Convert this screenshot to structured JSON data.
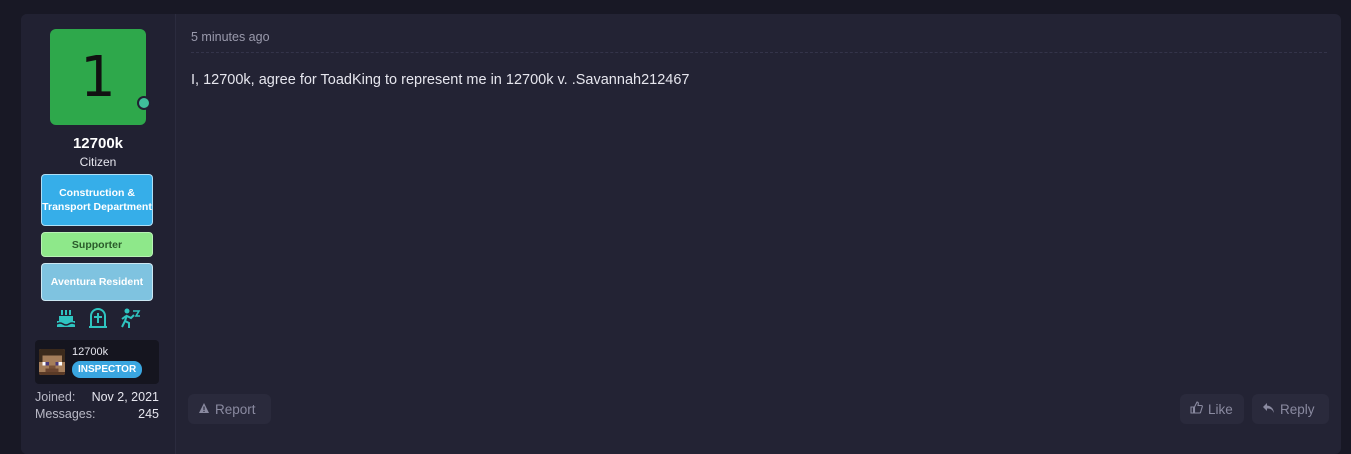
{
  "post": {
    "time": "5 minutes ago",
    "message": "I, 12700k, agree for ToadKing to represent me in 12700k v. .Savannah212467",
    "actions": {
      "report": "Report",
      "like": "Like",
      "reply": "Reply"
    }
  },
  "user": {
    "avatar_letter": "1",
    "avatar_color": "#2ea84b",
    "name": "12700k",
    "title": "Citizen",
    "banners": [
      {
        "label": "Construction & Transport Department",
        "color": "#36aee9"
      },
      {
        "label": "Supporter",
        "color": "#8ee88a"
      },
      {
        "label": "Aventura Resident",
        "color": "#7fc3e0"
      }
    ],
    "trophy_icons": [
      "birthday-cake-icon",
      "gravestone-icon",
      "runner-icon"
    ],
    "minecraft": {
      "name": "12700k",
      "badge": "INSPECTOR"
    },
    "stats": [
      {
        "label": "Joined:",
        "value": "Nov 2, 2021"
      },
      {
        "label": "Messages:",
        "value": "245"
      }
    ]
  }
}
